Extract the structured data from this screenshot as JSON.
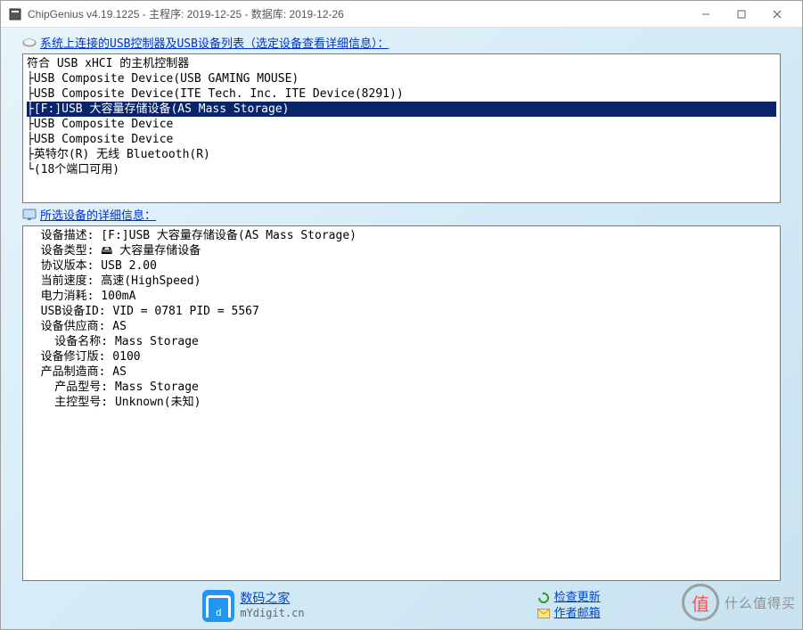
{
  "window": {
    "title": "ChipGenius v4.19.1225 - 主程序: 2019-12-25 - 数据库: 2019-12-26"
  },
  "section1": {
    "label": "系统上连接的USB控制器及USB设备列表（选定设备查看详细信息）："
  },
  "tree": {
    "root": "符合 USB xHCI 的主机控制器",
    "items": [
      "├USB Composite Device(USB GAMING MOUSE)",
      "├USB Composite Device(ITE Tech. Inc. ITE Device(8291))",
      "├[F:]USB 大容量存储设备(AS Mass Storage)",
      "├USB Composite Device",
      "├USB Composite Device",
      "├英特尔(R) 无线 Bluetooth(R)",
      "└(18个端口可用)"
    ],
    "selected_index": 2
  },
  "section2": {
    "label": "所选设备的详细信息："
  },
  "details": {
    "lines": [
      "  设备描述: [F:]USB 大容量存储设备(AS Mass Storage)",
      "  设备类型: 🖴 大容量存储设备",
      "",
      "  协议版本: USB 2.00",
      "  当前速度: 高速(HighSpeed)",
      "  电力消耗: 100mA",
      "",
      "  USB设备ID: VID = 0781 PID = 5567",
      "",
      "  设备供应商: AS",
      "    设备名称: Mass Storage",
      "  设备修订版: 0100",
      "",
      "  产品制造商: AS",
      "    产品型号: Mass Storage",
      "",
      "    主控型号: Unknown(未知)"
    ]
  },
  "links": {
    "home_top": "数码之家",
    "home_bot": "mYdigit.cn",
    "check_update": "检查更新",
    "author_mail": "作者邮箱"
  },
  "watermark": {
    "circle": "值",
    "text": "什么值得买"
  }
}
